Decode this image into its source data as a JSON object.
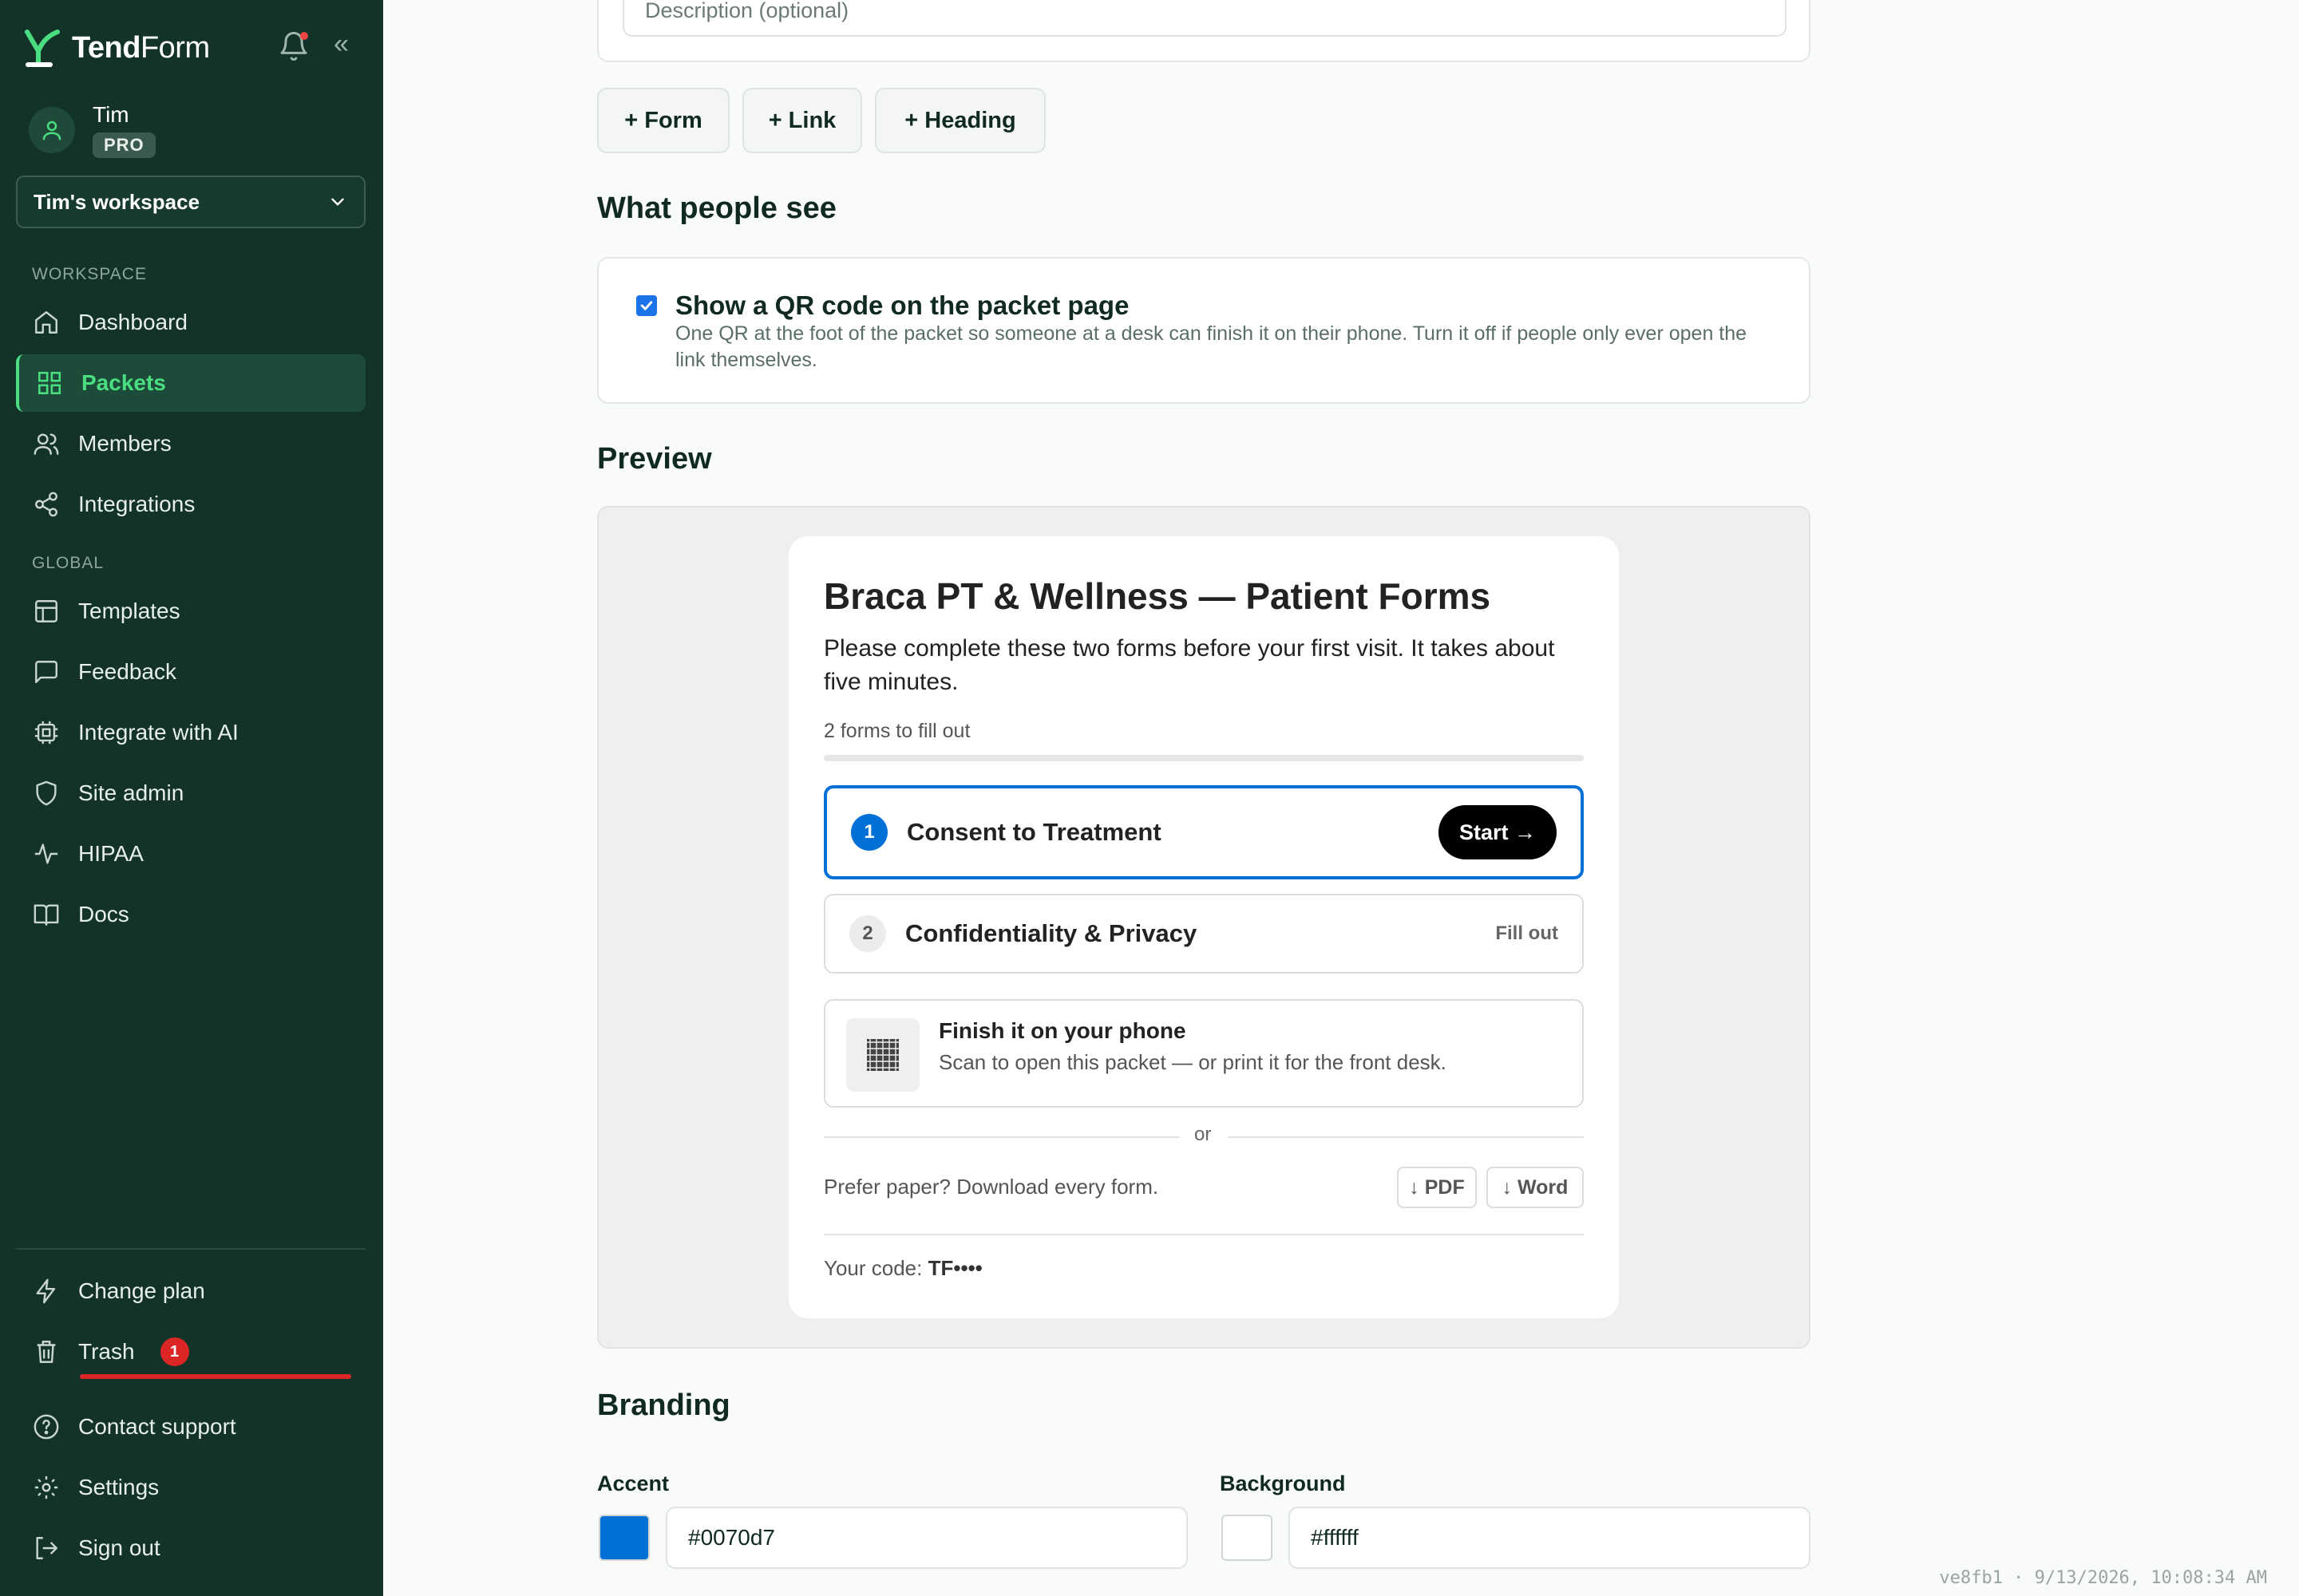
{
  "app": {
    "brand_bold": "Tend",
    "brand_thin": "Form"
  },
  "user": {
    "name": "Tim",
    "plan": "PRO"
  },
  "workspace": {
    "selected": "Tim's workspace"
  },
  "sidebar": {
    "workspace_section": "WORKSPACE",
    "global_section": "GLOBAL",
    "workspace_items": [
      {
        "label": "Dashboard",
        "icon": "home-icon"
      },
      {
        "label": "Packets",
        "icon": "grid-icon",
        "active": true
      },
      {
        "label": "Members",
        "icon": "users-icon"
      },
      {
        "label": "Integrations",
        "icon": "share-icon"
      }
    ],
    "global_items": [
      {
        "label": "Templates",
        "icon": "layout-icon"
      },
      {
        "label": "Feedback",
        "icon": "message-icon"
      },
      {
        "label": "Integrate with AI",
        "icon": "cpu-icon"
      },
      {
        "label": "Site admin",
        "icon": "shield-icon"
      },
      {
        "label": "HIPAA",
        "icon": "activity-icon"
      },
      {
        "label": "Docs",
        "icon": "book-icon"
      }
    ],
    "bottom_items": [
      {
        "label": "Change plan",
        "icon": "zap-icon"
      },
      {
        "label": "Trash",
        "icon": "trash-icon",
        "badge": "1"
      },
      {
        "label": "Contact support",
        "icon": "help-icon"
      },
      {
        "label": "Settings",
        "icon": "gear-icon"
      },
      {
        "label": "Sign out",
        "icon": "logout-icon"
      }
    ]
  },
  "editor": {
    "description_placeholder": "Description (optional)",
    "add_form": "+ Form",
    "add_link": "+ Link",
    "add_heading": "+ Heading"
  },
  "visibility": {
    "heading": "What people see",
    "qr_checked": true,
    "qr_title": "Show a QR code on the packet page",
    "qr_description": "One QR at the foot of the packet so someone at a desk can finish it on their phone. Turn it off if people only ever open the link themselves."
  },
  "preview": {
    "heading": "Preview",
    "title": "Braca PT & Wellness — Patient Forms",
    "subtitle": "Please complete these two forms before your first visit. It takes about five minutes.",
    "count": "2 forms to fill out",
    "forms": [
      {
        "num": "1",
        "name": "Consent to Treatment",
        "action": "Start →"
      },
      {
        "num": "2",
        "name": "Confidentiality & Privacy",
        "action": "Fill out"
      }
    ],
    "phone_title": "Finish it on your phone",
    "phone_sub": "Scan to open this packet — or print it for the front desk.",
    "or": "or",
    "paper_text": "Prefer paper? Download every form.",
    "pdf_btn": "↓ PDF",
    "word_btn": "↓ Word",
    "code_label": "Your code:",
    "code_value": "TF••••"
  },
  "branding": {
    "heading": "Branding",
    "accent_label": "Accent",
    "accent_value": "#0070d7",
    "background_label": "Background",
    "background_value": "#ffffff"
  },
  "footer": {
    "stamp": "ve8fb1 · 9/13/2026, 10:08:34 AM"
  },
  "colors": {
    "sidebar_bg": "#133228",
    "active_green": "#4ade80",
    "accent": "#0070d7",
    "danger": "#dc2626"
  }
}
